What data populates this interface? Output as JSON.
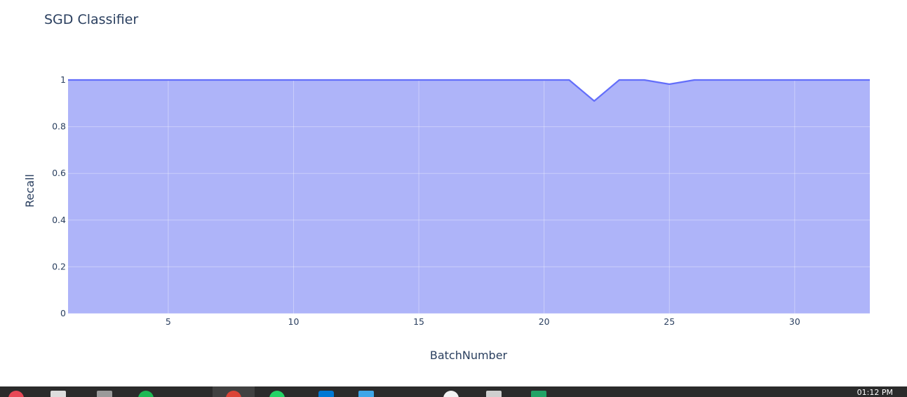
{
  "chart_data": {
    "type": "area",
    "title": "SGD Classifier",
    "xlabel": "BatchNumber",
    "ylabel": "Recall",
    "x": [
      1,
      2,
      3,
      4,
      5,
      6,
      7,
      8,
      9,
      10,
      11,
      12,
      13,
      14,
      15,
      16,
      17,
      18,
      19,
      20,
      21,
      22,
      23,
      24,
      25,
      26,
      27,
      28,
      29,
      30,
      31,
      32,
      33
    ],
    "y": [
      1,
      1,
      1,
      1,
      1,
      1,
      1,
      1,
      1,
      1,
      1,
      1,
      1,
      1,
      1,
      1,
      1,
      1,
      1,
      1,
      1,
      0.91,
      1,
      1,
      0.982,
      1,
      1,
      1,
      1,
      1,
      1,
      1,
      1
    ],
    "xlim": [
      1,
      33
    ],
    "ylim": [
      0,
      1.05
    ],
    "xticks": [
      5,
      10,
      15,
      20,
      25,
      30
    ],
    "yticks": [
      0,
      0.2,
      0.4,
      0.6,
      0.8,
      1
    ],
    "ytick_labels": [
      "0",
      "0.2",
      "0.4",
      "0.6",
      "0.8",
      "1"
    ],
    "grid": true,
    "fill_color": "#aeb4f9",
    "line_color": "#636efa"
  },
  "taskbar": {
    "clock": "01:12 PM",
    "background": "#2b2b2b",
    "icons": [
      "app-icon-red",
      "file-icon",
      "folder-icon",
      "spotify-icon",
      "chrome-icon",
      "whatsapp-icon",
      "vscode-icon",
      "store-icon",
      "app-icon-white",
      "mail-icon",
      "excel-icon"
    ]
  }
}
